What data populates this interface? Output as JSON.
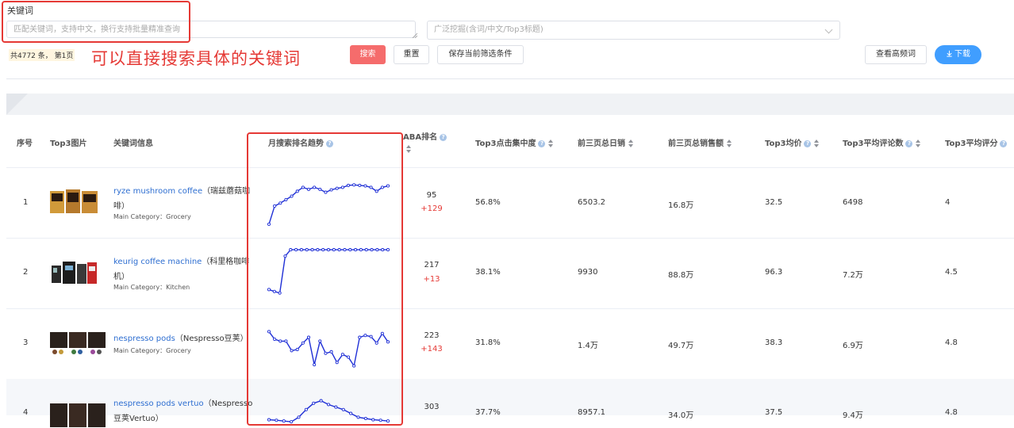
{
  "filters": {
    "keyword_label": "关键词",
    "keyword_placeholder": "匹配关键词，支持中文，换行支持批量精准查询",
    "broad_placeholder": "广泛挖掘(含词/中文/Top3标题)",
    "count_text": "共4772 条， 第1页",
    "annotation": "可以直接搜索具体的关键词"
  },
  "buttons": {
    "search": "搜索",
    "reset": "重置",
    "save": "保存当前筛选条件",
    "high_freq": "查看高频词",
    "download": "下载"
  },
  "table": {
    "headers": {
      "index": "序号",
      "top3_image": "Top3图片",
      "keyword_info": "关键词信息",
      "trend": "月搜索排名趋势",
      "aba_rank": "ABA排名",
      "click_concentration": "Top3点击集中度",
      "daily_sales": "前三页总日销",
      "sales_amount": "前三页总销售额",
      "avg_price": "Top3均价",
      "avg_reviews": "Top3平均评论数",
      "avg_rating": "Top3平均评分"
    },
    "rows": [
      {
        "index": "1",
        "keyword_en": "ryze mushroom coffee",
        "keyword_cn_line1": "（瑞兹蘑菇咖",
        "keyword_cn_line2": "啡）",
        "main_category": "Main Category：Grocery",
        "rank": "95",
        "rank_change": "+129",
        "click_concentration": "56.8%",
        "daily_sales": "6503.2",
        "sales_amount": "16.8万",
        "avg_price": "32.5",
        "avg_reviews": "6498",
        "avg_rating": "4",
        "trend": [
          0.95,
          0.58,
          0.52,
          0.45,
          0.38,
          0.28,
          0.2,
          0.24,
          0.2,
          0.24,
          0.3,
          0.25,
          0.22,
          0.2,
          0.16,
          0.15,
          0.16,
          0.17,
          0.2,
          0.28,
          0.2,
          0.17
        ]
      },
      {
        "index": "2",
        "keyword_en": "keurig coffee machine",
        "keyword_cn_line1": "（科里格咖啡",
        "keyword_cn_line2": "机）",
        "main_category": "Main Category：Kitchen",
        "rank": "217",
        "rank_change": "+13",
        "click_concentration": "38.1%",
        "daily_sales": "9930",
        "sales_amount": "88.8万",
        "avg_price": "96.3",
        "avg_reviews": "7.2万",
        "avg_rating": "4.5",
        "trend": [
          0.86,
          0.9,
          0.93,
          0.18,
          0.05,
          0.05,
          0.05,
          0.05,
          0.05,
          0.05,
          0.05,
          0.05,
          0.05,
          0.05,
          0.05,
          0.05,
          0.05,
          0.05,
          0.05,
          0.05,
          0.05,
          0.05,
          0.05
        ]
      },
      {
        "index": "3",
        "keyword_en": "nespresso pods",
        "keyword_cn_line1": "（Nespresso豆荚）",
        "keyword_cn_line2": "",
        "main_category": "Main Category：Grocery",
        "rank": "223",
        "rank_change": "+143",
        "click_concentration": "31.8%",
        "daily_sales": "1.4万",
        "sales_amount": "49.7万",
        "avg_price": "38.3",
        "avg_reviews": "6.9万",
        "avg_rating": "4.8",
        "trend": [
          0.05,
          0.25,
          0.3,
          0.3,
          0.55,
          0.52,
          0.35,
          0.2,
          0.92,
          0.3,
          0.62,
          0.58,
          0.86,
          0.65,
          0.72,
          0.95,
          0.2,
          0.15,
          0.18,
          0.35,
          0.1,
          0.32
        ]
      },
      {
        "index": "4",
        "keyword_en": "nespresso pods vertuo",
        "keyword_cn_line1": "（Nespresso",
        "keyword_cn_line2": "豆荚Vertuo）",
        "main_category": "",
        "rank": "303",
        "rank_change": "",
        "click_concentration": "37.7%",
        "daily_sales": "8957.1",
        "sales_amount": "34.0万",
        "avg_price": "37.5",
        "avg_reviews": "9.4万",
        "avg_rating": "4.8",
        "trend": [
          0.8,
          0.82,
          0.85,
          0.88,
          0.7,
          0.4,
          0.15,
          0.05,
          0.2,
          0.3,
          0.4,
          0.55,
          0.7,
          0.75,
          0.8,
          0.82,
          0.85
        ]
      }
    ]
  },
  "colors": {
    "accent_red": "#e53935",
    "link_blue": "#2f6fd1",
    "trend_line": "#1f2fd6",
    "primary": "#409eff",
    "danger": "#f56c6c"
  }
}
